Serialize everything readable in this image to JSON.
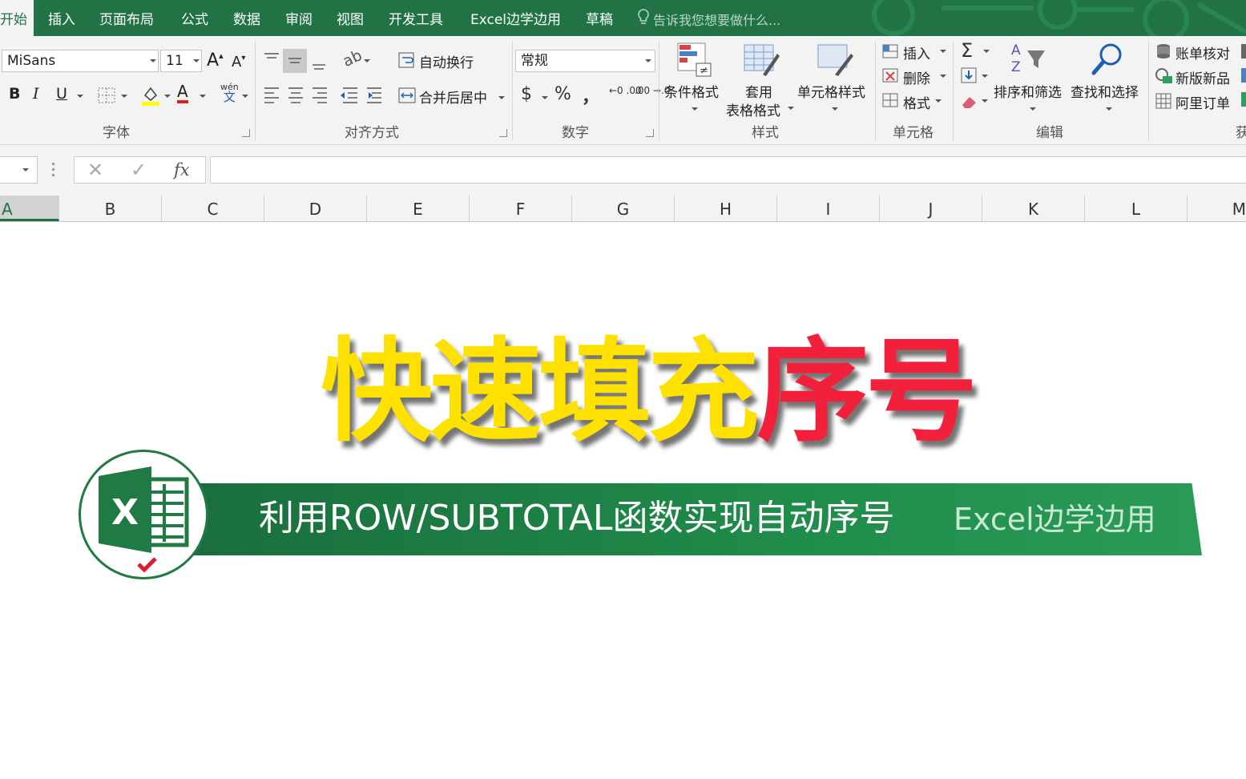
{
  "tabs": [
    {
      "label": "开始",
      "active": true
    },
    {
      "label": "插入"
    },
    {
      "label": "页面布局"
    },
    {
      "label": "公式"
    },
    {
      "label": "数据"
    },
    {
      "label": "审阅"
    },
    {
      "label": "视图"
    },
    {
      "label": "开发工具"
    },
    {
      "label": "Excel边学边用"
    },
    {
      "label": "草稿"
    }
  ],
  "tell_me": "告诉我您想要做什么...",
  "font": {
    "name": "MiSans",
    "size": "11",
    "group_label": "字体",
    "phonetic_top": "wén",
    "phonetic_bottom": "文"
  },
  "alignment": {
    "wrap_text": "自动换行",
    "merge_center": "合并后居中",
    "group_label": "对齐方式"
  },
  "number": {
    "format": "常规",
    "currency": "$",
    "percent": "%",
    "comma": "，",
    "inc_decimal": "←0 .00",
    "dec_decimal": ".00 →.0",
    "group_label": "数字"
  },
  "styles": {
    "conditional": "条件格式",
    "table_format_1": "套用",
    "table_format_2": "表格格式",
    "cell_styles": "单元格样式",
    "group_label": "样式"
  },
  "cells": {
    "insert": "插入",
    "delete": "删除",
    "format": "格式",
    "group_label": "单元格"
  },
  "editing": {
    "sort_filter": "排序和筛选",
    "find_select": "查找和选择",
    "group_label": "编辑"
  },
  "addins": {
    "item1": "账单核对",
    "item2": "新版新品",
    "item3": "阿里订单",
    "group_label": "获"
  },
  "formula_bar": {
    "fx": "fx"
  },
  "columns": [
    "A",
    "B",
    "C",
    "D",
    "E",
    "F",
    "G",
    "H",
    "I",
    "J",
    "K",
    "L",
    "M"
  ],
  "selected_column": "A",
  "headline": {
    "part_yellow": "快速填充",
    "part_red": "序号"
  },
  "banner": {
    "text": "利用ROW/SUBTOTAL函数实现自动序号",
    "brand": "Excel边学边用"
  },
  "colors": {
    "excel_green": "#217346",
    "headline_yellow": "#ffe100",
    "headline_red": "#f2203a"
  }
}
